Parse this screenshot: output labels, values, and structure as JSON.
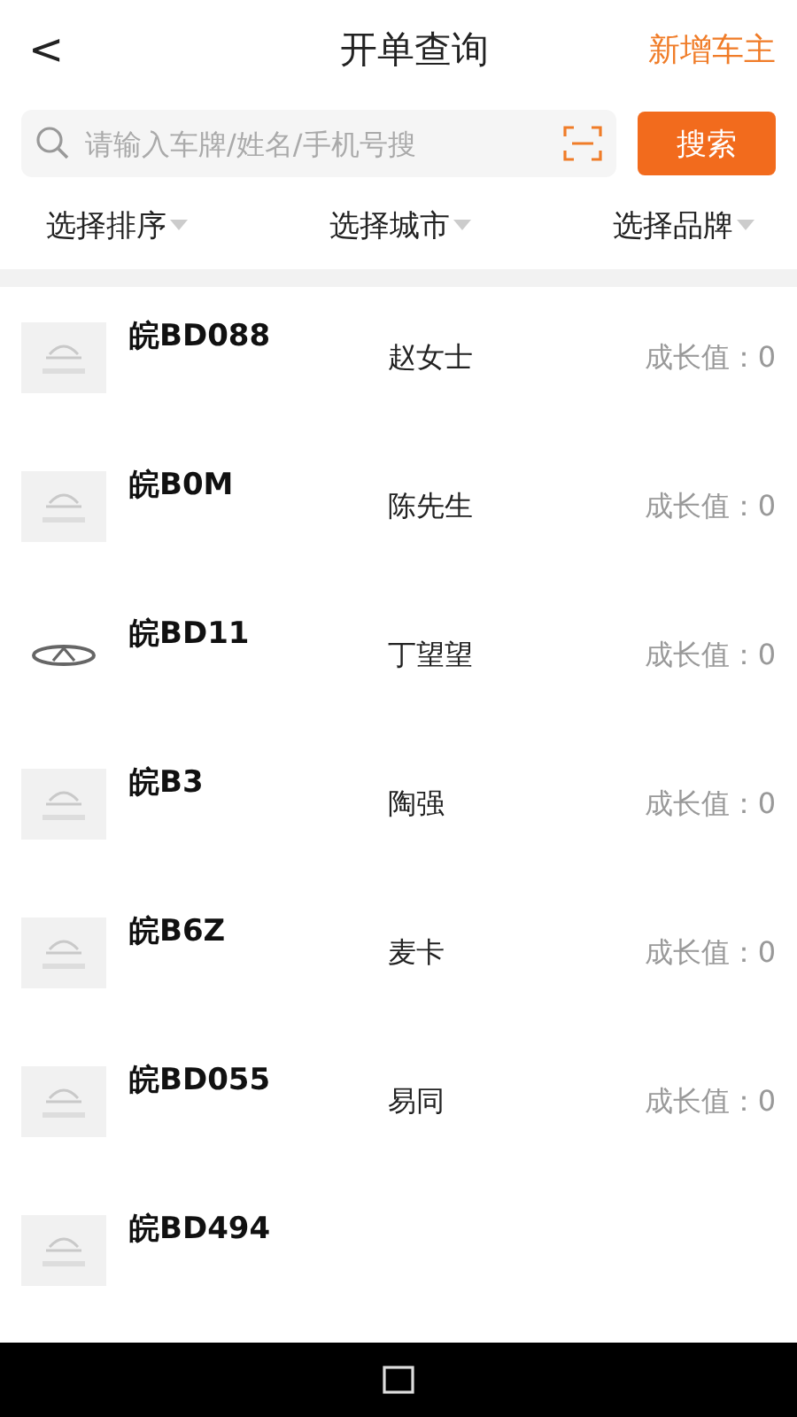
{
  "header": {
    "back_icon": "<",
    "title": "开单查询",
    "action": "新增车主"
  },
  "search": {
    "placeholder": "请输入车牌/姓名/手机号搜",
    "button": "搜索"
  },
  "filters": [
    {
      "label": "选择排序"
    },
    {
      "label": "选择城市"
    },
    {
      "label": "选择品牌"
    }
  ],
  "rows": [
    {
      "kind": "placeholder",
      "plate": "皖BD088",
      "name": "赵女士",
      "growth": "成长值：0"
    },
    {
      "kind": "placeholder",
      "plate": "皖B0M",
      "name": "陈先生",
      "growth": "成长值：0"
    },
    {
      "kind": "emblem",
      "plate": "皖BD11",
      "name": "丁望望",
      "growth": "成长值：0"
    },
    {
      "kind": "placeholder",
      "plate": "皖B3",
      "name": "陶强",
      "growth": "成长值：0"
    },
    {
      "kind": "placeholder",
      "plate": "皖B6Z",
      "name": "麦卡",
      "growth": "成长值：0"
    },
    {
      "kind": "placeholder",
      "plate": "皖BD055",
      "name": "易同",
      "growth": "成长值：0"
    },
    {
      "kind": "placeholder",
      "plate": "皖BD494"
    }
  ]
}
